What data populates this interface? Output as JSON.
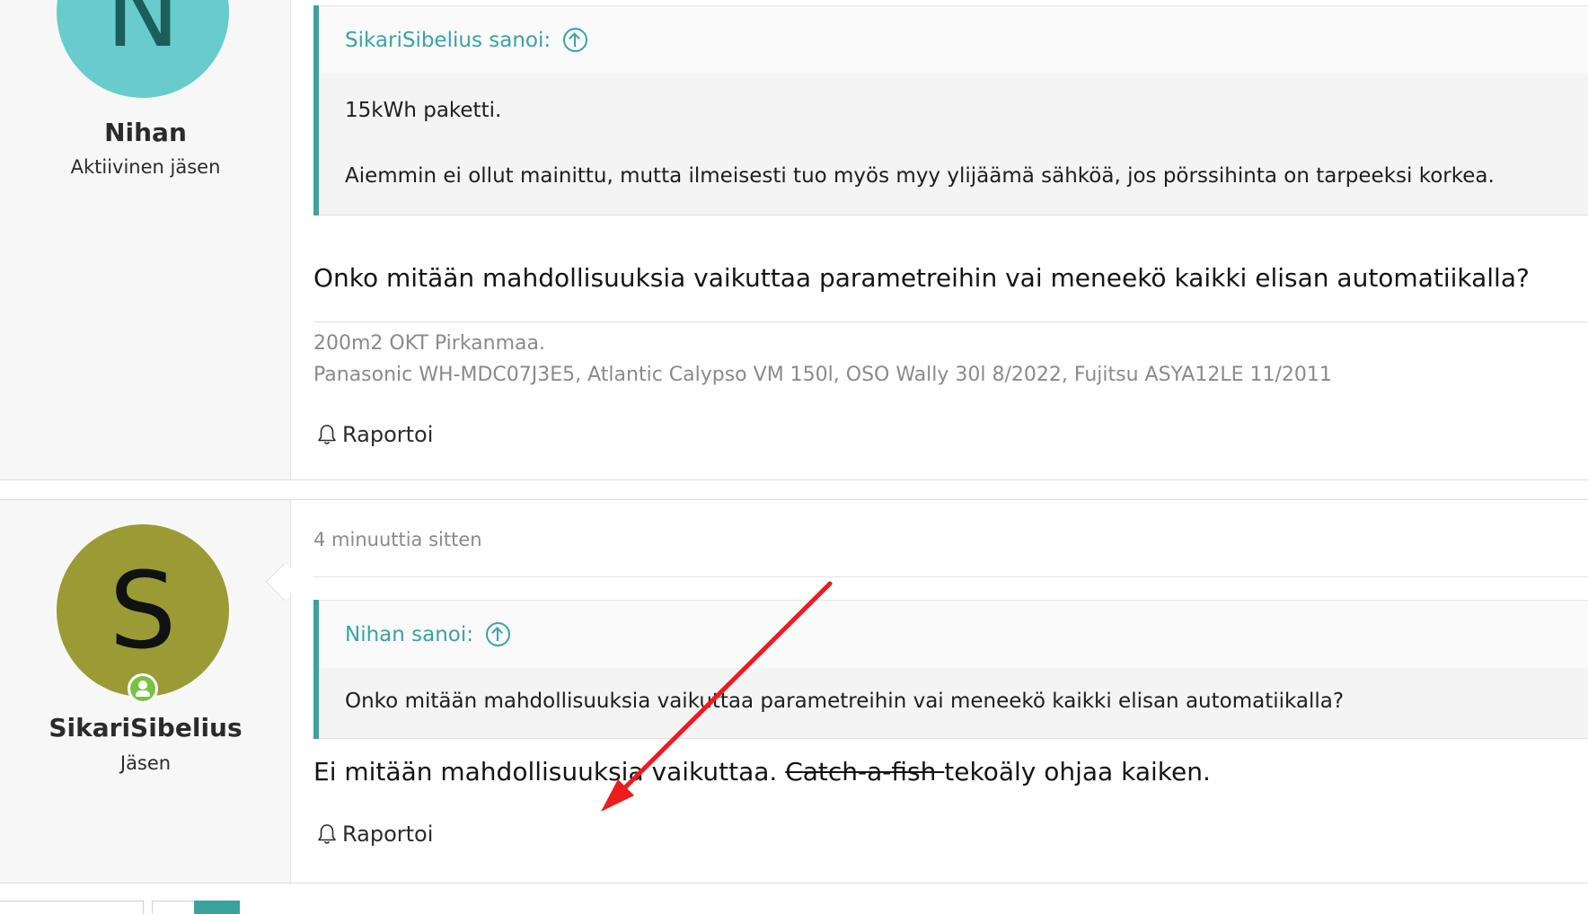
{
  "posts": [
    {
      "avatar_letter": "N",
      "username": "Nihan",
      "user_title": "Aktiivinen jäsen",
      "quote": {
        "author_label": "SikariSibelius sanoi:",
        "lines": [
          "15kWh paketti.",
          "Aiemmin ei ollut mainittu, mutta ilmeisesti tuo myös myy ylijäämä sähköä, jos pörssihinta on tarpeeksi korkea."
        ]
      },
      "body": "Onko mitään mahdollisuuksia vaikuttaa parametreihin vai meneekö kaikki elisan automatiikalla?",
      "signature": [
        "200m2 OKT Pirkanmaa.",
        "Panasonic WH-MDC07J3E5, Atlantic Calypso VM 150l, OSO Wally 30l 8/2022, Fujitsu ASYA12LE 11/2011"
      ],
      "report_label": "Raportoi"
    },
    {
      "avatar_letter": "S",
      "username": "SikariSibelius",
      "user_title": "Jäsen",
      "time": "4 minuuttia sitten",
      "quote": {
        "author_label": "Nihan sanoi:",
        "lines": [
          "Onko mitään mahdollisuuksia vaikuttaa parametreihin vai meneekö kaikki elisan automatiikalla?"
        ]
      },
      "body_parts": {
        "before": "Ei mitään mahdollisuuksia vaikuttaa. ",
        "struck": "Catch-a-fish ",
        "after": "tekoäly ohjaa kaiken."
      },
      "report_label": "Raportoi"
    }
  ],
  "colors": {
    "accent": "#3aa3a0",
    "avatar_n": "#67cccb",
    "avatar_s": "#9b9b35",
    "online": "#7ac143",
    "annotation_arrow": "#ee1c1c"
  }
}
